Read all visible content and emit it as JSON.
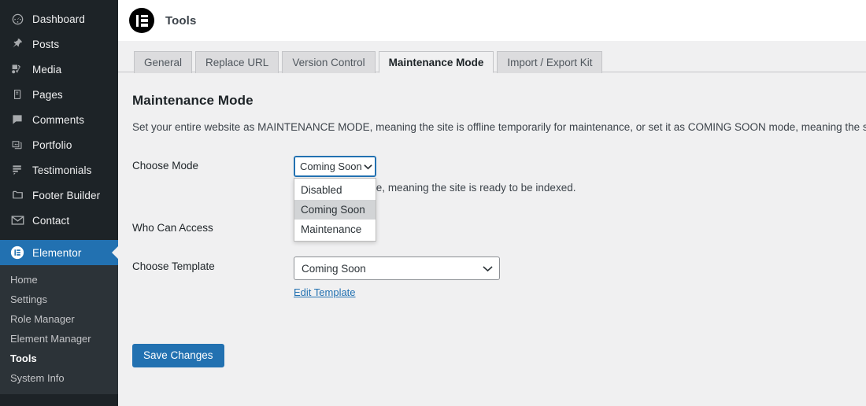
{
  "sidebar": {
    "items": [
      {
        "label": "Dashboard",
        "icon": "dashboard-icon",
        "current": false
      },
      {
        "label": "Posts",
        "icon": "pin-icon",
        "current": false
      },
      {
        "label": "Media",
        "icon": "media-icon",
        "current": false
      },
      {
        "label": "Pages",
        "icon": "pages-icon",
        "current": false
      },
      {
        "label": "Comments",
        "icon": "comments-icon",
        "current": false
      },
      {
        "label": "Portfolio",
        "icon": "portfolio-icon",
        "current": false
      },
      {
        "label": "Testimonials",
        "icon": "testimonials-icon",
        "current": false
      },
      {
        "label": "Footer Builder",
        "icon": "folder-icon",
        "current": false
      },
      {
        "label": "Contact",
        "icon": "envelope-icon",
        "current": false
      },
      {
        "label": "Elementor",
        "icon": "elementor-icon",
        "current": true
      }
    ],
    "submenu": [
      {
        "label": "Home",
        "current": false
      },
      {
        "label": "Settings",
        "current": false
      },
      {
        "label": "Role Manager",
        "current": false
      },
      {
        "label": "Element Manager",
        "current": false
      },
      {
        "label": "Tools",
        "current": true
      },
      {
        "label": "System Info",
        "current": false
      }
    ],
    "colors": {
      "background": "#1d2327",
      "submenu_background": "#2c3338",
      "current_highlight": "#2271b1"
    }
  },
  "header": {
    "logo_icon": "elementor-logo-icon",
    "title": "Tools"
  },
  "tabs": [
    {
      "label": "General",
      "active": false
    },
    {
      "label": "Replace URL",
      "active": false
    },
    {
      "label": "Version Control",
      "active": false
    },
    {
      "label": "Maintenance Mode",
      "active": true
    },
    {
      "label": "Import / Export Kit",
      "active": false
    }
  ],
  "main": {
    "section_title": "Maintenance Mode",
    "section_description": "Set your entire website as MAINTENANCE MODE, meaning the site is offline temporarily for maintenance, or set it as COMING SOON mode, meaning the site is offline until it",
    "fields": {
      "choose_mode": {
        "label": "Choose Mode",
        "value": "Coming Soon",
        "hint": "ns HTTP 200 code, meaning the site is ready to be indexed.",
        "chevron_icon": "chevron-down-icon",
        "options": [
          {
            "label": "Disabled",
            "selected": false
          },
          {
            "label": "Coming Soon",
            "selected": true
          },
          {
            "label": "Maintenance",
            "selected": false
          }
        ],
        "focus_color": "#2271b1"
      },
      "who_can_access": {
        "label": "Who Can Access"
      },
      "choose_template": {
        "label": "Choose Template",
        "value": "Coming Soon",
        "chevron_icon": "chevron-down-icon",
        "edit_link": "Edit Template"
      }
    },
    "save_label": "Save Changes",
    "accent_color": "#2271b1"
  }
}
